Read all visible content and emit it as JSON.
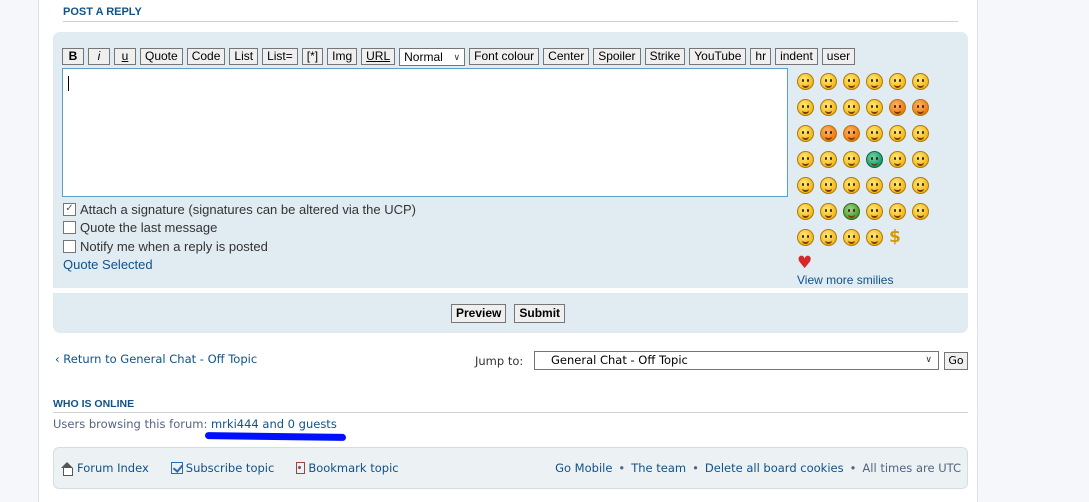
{
  "reply": {
    "title": "POST A REPLY"
  },
  "toolbar": {
    "bold": "B",
    "italic": "i",
    "underline": "u",
    "quote": "Quote",
    "code": "Code",
    "list": "List",
    "list_ordered": "List=",
    "list_item": "[*]",
    "img": "Img",
    "url": "URL",
    "font_size": "Normal",
    "font_colour": "Font colour",
    "center": "Center",
    "spoiler": "Spoiler",
    "strike": "Strike",
    "youtube": "YouTube",
    "hr": "hr",
    "indent": "indent",
    "user": "user"
  },
  "options": {
    "attach_signature": "Attach a signature (signatures can be altered via the UCP)",
    "attach_signature_checked": true,
    "quote_last": "Quote the last message",
    "quote_last_checked": false,
    "notify": "Notify me when a reply is posted",
    "notify_checked": false,
    "quote_selected": "Quote Selected"
  },
  "smilies": {
    "view_more": "View more smilies"
  },
  "actions": {
    "preview": "Preview",
    "submit": "Submit"
  },
  "nav": {
    "return_link": "Return to General Chat - Off Topic",
    "jump_label": "Jump to:",
    "jump_value": "General Chat - Off Topic",
    "go": "Go"
  },
  "online": {
    "title": "WHO IS ONLINE",
    "prefix": "Users browsing this forum:",
    "user": "mrki444",
    "suffix": "and 0 guests"
  },
  "footer": {
    "forum_index": "Forum Index",
    "subscribe": "Subscribe topic",
    "bookmark": "Bookmark topic",
    "go_mobile": "Go Mobile",
    "team": "The team",
    "delete_cookies": "Delete all board cookies",
    "timezone": "All times are UTC"
  },
  "colors": {
    "link": "#105289",
    "panel": "#e1ebf2",
    "annotation": "#0010ff"
  }
}
